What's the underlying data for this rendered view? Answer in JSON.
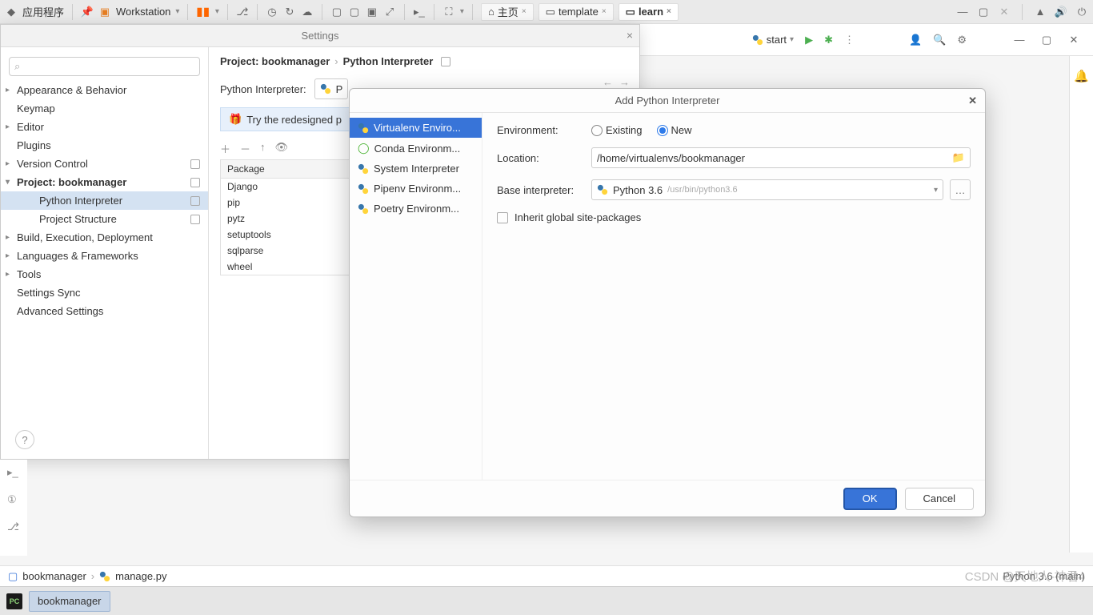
{
  "sysbar": {
    "applications": "应用程序",
    "workstation": "Workstation",
    "tabs": [
      {
        "label": "主页"
      },
      {
        "label": "template"
      },
      {
        "label": "learn",
        "active": true
      }
    ]
  },
  "ide_top": {
    "run_config": "start"
  },
  "settings": {
    "title": "Settings",
    "search_placeholder": "",
    "tree": [
      {
        "label": "Appearance & Behavior",
        "chev": true
      },
      {
        "label": "Keymap"
      },
      {
        "label": "Editor",
        "chev": true
      },
      {
        "label": "Plugins"
      },
      {
        "label": "Version Control",
        "chev": true,
        "badge": true
      },
      {
        "label": "Project: bookmanager",
        "chev": true,
        "open": true,
        "bold": true,
        "badge": true
      },
      {
        "label": "Python Interpreter",
        "sub": true,
        "selected": true,
        "badge": true
      },
      {
        "label": "Project Structure",
        "sub": true,
        "badge": true
      },
      {
        "label": "Build, Execution, Deployment",
        "chev": true
      },
      {
        "label": "Languages & Frameworks",
        "chev": true
      },
      {
        "label": "Tools",
        "chev": true
      },
      {
        "label": "Settings Sync"
      },
      {
        "label": "Advanced Settings"
      }
    ],
    "breadcrumb": {
      "p1": "Project: bookmanager",
      "p2": "Python Interpreter"
    },
    "interpreter_label": "Python Interpreter:",
    "interpreter_value": "P",
    "banner": "Try the redesigned p",
    "pkg_header": "Package",
    "packages": [
      "Django",
      "pip",
      "pytz",
      "setuptools",
      "sqlparse",
      "wheel"
    ]
  },
  "add_dialog": {
    "title": "Add Python Interpreter",
    "types": [
      "Virtualenv Enviro...",
      "Conda Environm...",
      "System Interpreter",
      "Pipenv Environm...",
      "Poetry Environm..."
    ],
    "env_label": "Environment:",
    "radio_existing": "Existing",
    "radio_new": "New",
    "location_label": "Location:",
    "location_value": "/home/virtualenvs/bookmanager",
    "base_label": "Base interpreter:",
    "base_value": "Python 3.6",
    "base_path": "/usr/bin/python3.6",
    "inherit_label": "Inherit global site-packages",
    "ok": "OK",
    "cancel": "Cancel"
  },
  "bottom": {
    "project": "bookmanager",
    "file": "manage.py",
    "status": "Python 3.6 (main)"
  },
  "taskbar": {
    "item": "bookmanager"
  },
  "watermark": "CSDN @天地人-神君4"
}
